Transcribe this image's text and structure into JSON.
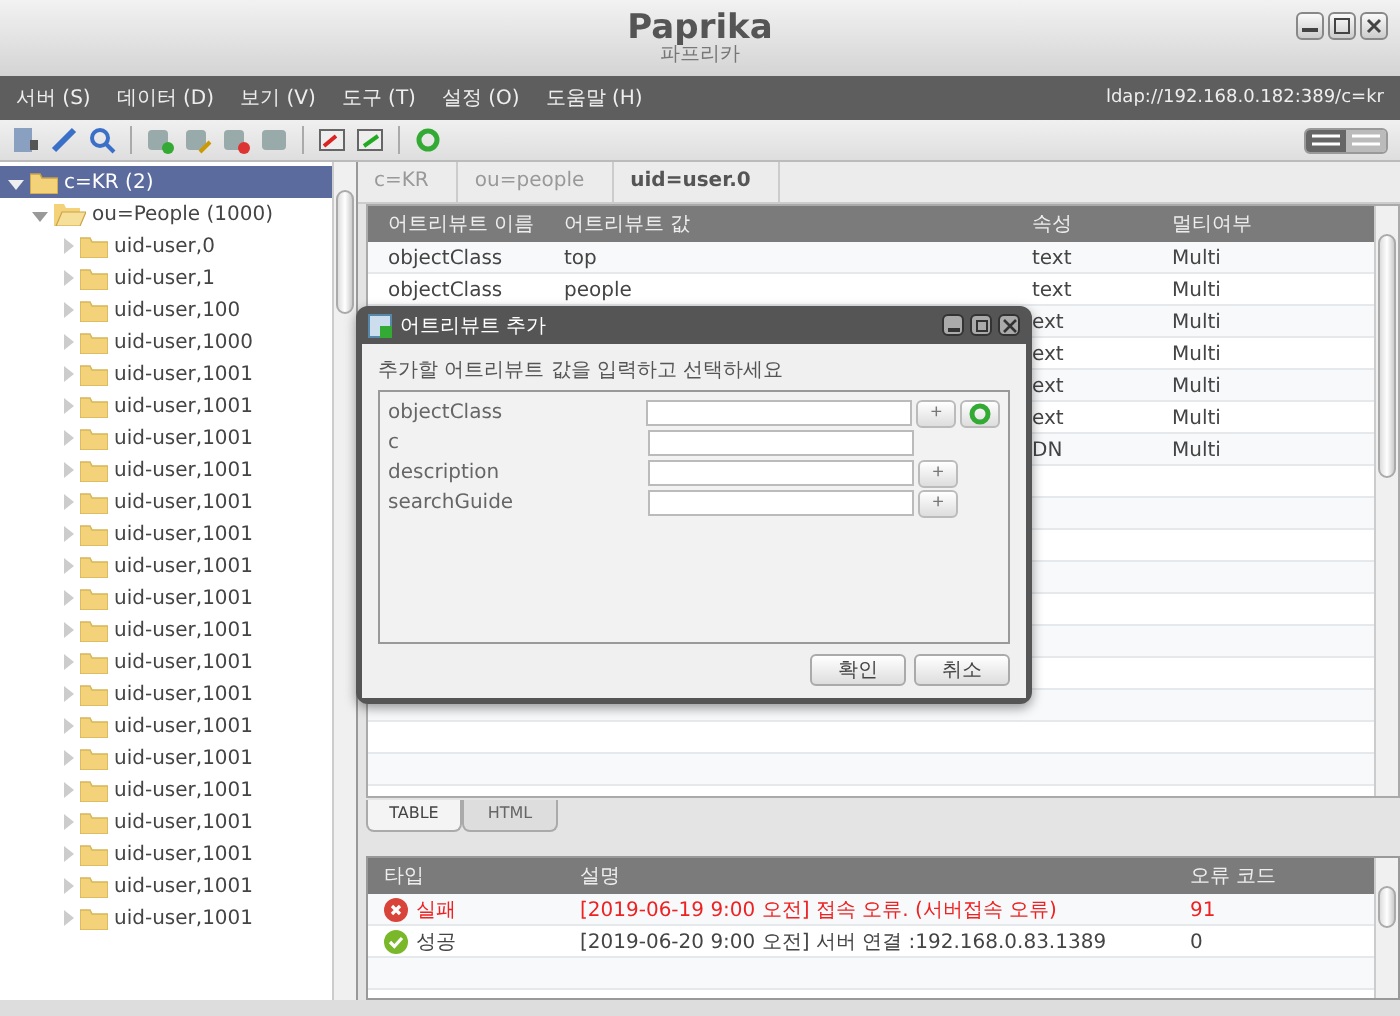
{
  "window": {
    "logo": "Paprika",
    "logo_sub": "파프리카"
  },
  "menu": [
    "서버 (S)",
    "데이터 (D)",
    "보기 (V)",
    "도구 (T)",
    "설정 (O)",
    "도움말 (H)"
  ],
  "connection": "ldap://192.168.0.182:389/c=kr",
  "view_toggle": [
    {
      "selected": true
    },
    {
      "selected": false
    }
  ],
  "tree": {
    "label": "c=KR (2)",
    "selected": true,
    "expanded": true,
    "children": [
      {
        "label": "ou=People (1000)",
        "selected": false,
        "expanded": true,
        "children": [
          {
            "label": "uid-user,0",
            "selected": false,
            "expanded": false
          },
          {
            "label": "uid-user,1",
            "selected": false,
            "expanded": false
          },
          {
            "label": "uid-user,100",
            "selected": false,
            "expanded": false
          },
          {
            "label": "uid-user,1000",
            "selected": false,
            "expanded": false
          },
          {
            "label": "uid-user,1001",
            "selected": false,
            "expanded": false
          },
          {
            "label": "uid-user,1001",
            "selected": false,
            "expanded": false
          },
          {
            "label": "uid-user,1001",
            "selected": false,
            "expanded": false
          },
          {
            "label": "uid-user,1001",
            "selected": false,
            "expanded": false
          },
          {
            "label": "uid-user,1001",
            "selected": false,
            "expanded": false
          },
          {
            "label": "uid-user,1001",
            "selected": false,
            "expanded": false
          },
          {
            "label": "uid-user,1001",
            "selected": false,
            "expanded": false
          },
          {
            "label": "uid-user,1001",
            "selected": false,
            "expanded": false
          },
          {
            "label": "uid-user,1001",
            "selected": false,
            "expanded": false
          },
          {
            "label": "uid-user,1001",
            "selected": false,
            "expanded": false
          },
          {
            "label": "uid-user,1001",
            "selected": false,
            "expanded": false
          },
          {
            "label": "uid-user,1001",
            "selected": false,
            "expanded": false
          },
          {
            "label": "uid-user,1001",
            "selected": false,
            "expanded": false
          },
          {
            "label": "uid-user,1001",
            "selected": false,
            "expanded": false
          },
          {
            "label": "uid-user,1001",
            "selected": false,
            "expanded": false
          },
          {
            "label": "uid-user,1001",
            "selected": false,
            "expanded": false
          },
          {
            "label": "uid-user,1001",
            "selected": false,
            "expanded": false
          },
          {
            "label": "uid-user,1001",
            "selected": false,
            "expanded": false
          }
        ]
      }
    ]
  },
  "breadcrumb": [
    {
      "label": "c=KR",
      "selected": false
    },
    {
      "label": "ou=people",
      "selected": false
    },
    {
      "label": "uid=user.0",
      "selected": true
    }
  ],
  "table": {
    "columns": [
      "어트리뷰트 이름",
      "어트리뷰트 값",
      "속성",
      "멀티여부"
    ],
    "rows": [
      [
        "objectClass",
        "top",
        "text",
        "Multi"
      ],
      [
        "objectClass",
        "people",
        "text",
        "Multi"
      ],
      [
        "",
        "",
        "ext",
        "Multi"
      ],
      [
        "",
        "",
        "ext",
        "Multi"
      ],
      [
        "",
        "",
        "ext",
        "Multi"
      ],
      [
        "",
        "",
        "ext",
        "Multi"
      ],
      [
        "",
        "",
        "DN",
        "Multi"
      ]
    ]
  },
  "tabs": [
    {
      "label": "TABLE",
      "selected": true
    },
    {
      "label": "HTML",
      "selected": false
    }
  ],
  "log": {
    "columns": [
      "타입",
      "설명",
      "오류 코드"
    ],
    "rows": [
      {
        "kind": "error",
        "type": "실패",
        "message": "[2019-06-19 9:00 오전] 접속 오류. (서버접속 오류)",
        "code": "91"
      },
      {
        "kind": "success",
        "type": "성공",
        "message": "[2019-06-20 9:00 오전] 서버 연결 :192.168.0.83.1389",
        "code": "0"
      }
    ]
  },
  "dialog": {
    "title": "어트리뷰트 추가",
    "instruction": "추가할 어트리뷰트 값을 입력하고 선택하세요",
    "fields": [
      {
        "label": "objectClass",
        "add": "+",
        "refresh": true
      },
      {
        "label": "c",
        "refresh": false
      },
      {
        "label": "description",
        "add": "+",
        "refresh": false
      },
      {
        "label": "searchGuide",
        "add": "+",
        "refresh": false
      }
    ],
    "buttons": [
      "확인",
      "취소"
    ]
  }
}
